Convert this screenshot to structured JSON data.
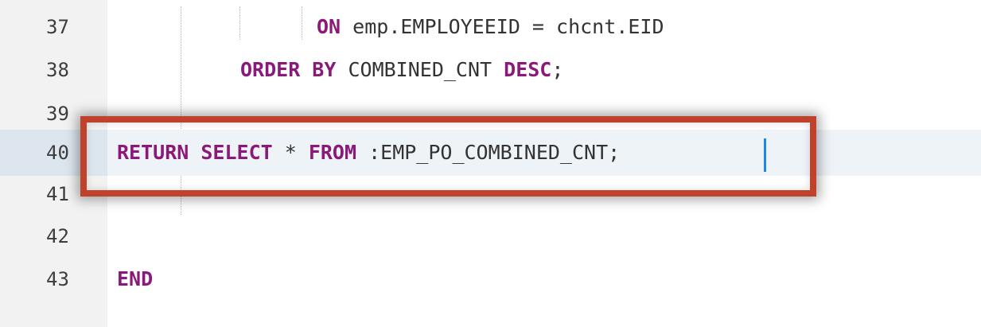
{
  "editor": {
    "lines": [
      {
        "number": "37",
        "tokens": [
          {
            "text": "ON",
            "kw": true
          },
          {
            "text": " emp.EMPLOYEEID = chcnt.EID",
            "kw": false
          }
        ]
      },
      {
        "number": "38",
        "tokens": [
          {
            "text": "ORDER BY",
            "kw": true
          },
          {
            "text": " COMBINED_CNT ",
            "kw": false
          },
          {
            "text": "DESC",
            "kw": true
          },
          {
            "text": ";",
            "kw": false
          }
        ]
      },
      {
        "number": "39",
        "tokens": []
      },
      {
        "number": "40",
        "tokens": [
          {
            "text": "RETURN SELECT",
            "kw": true
          },
          {
            "text": " * ",
            "kw": false
          },
          {
            "text": "FROM",
            "kw": true
          },
          {
            "text": " :EMP_PO_COMBINED_CNT;",
            "kw": false
          }
        ]
      },
      {
        "number": "41",
        "tokens": []
      },
      {
        "number": "42",
        "tokens": []
      },
      {
        "number": "43",
        "tokens": [
          {
            "text": "END",
            "kw": true
          }
        ]
      }
    ],
    "current_line": "40",
    "highlight_color": "#c0422c",
    "keyword_color": "#8a1a7a"
  }
}
